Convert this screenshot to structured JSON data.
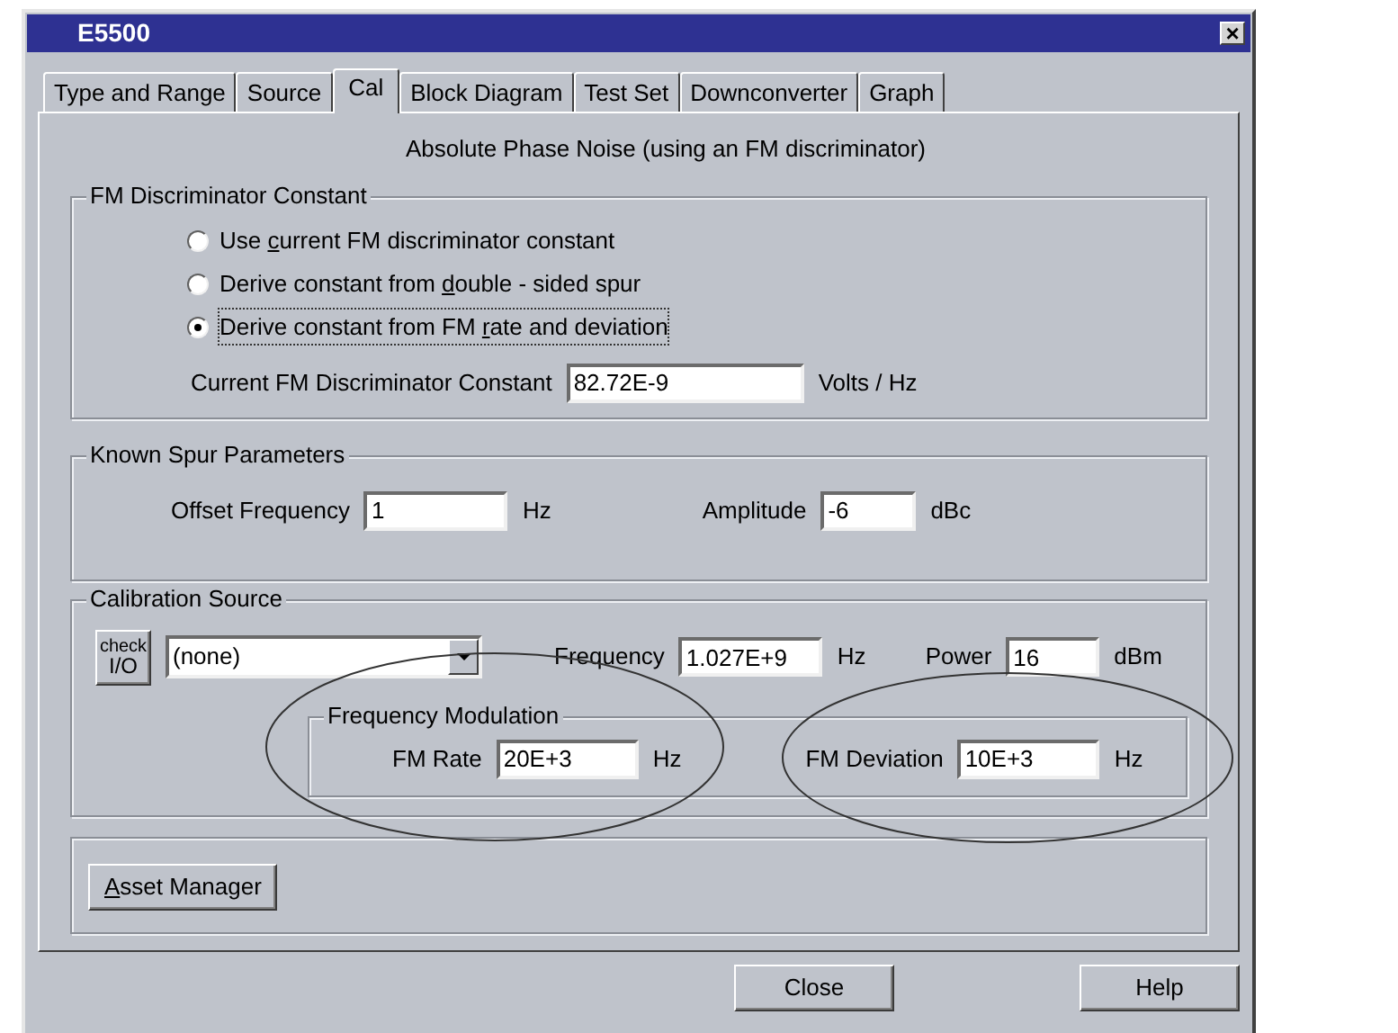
{
  "window": {
    "title": "E5500",
    "close_glyph": "×"
  },
  "tabs": [
    {
      "label": "Type and Range",
      "selected": false
    },
    {
      "label": "Source",
      "selected": false
    },
    {
      "label": "Cal",
      "selected": true
    },
    {
      "label": "Block Diagram",
      "selected": false
    },
    {
      "label": "Test Set",
      "selected": false
    },
    {
      "label": "Downconverter",
      "selected": false
    },
    {
      "label": "Graph",
      "selected": false
    }
  ],
  "heading": "Absolute Phase Noise (using an FM discriminator)",
  "discriminator": {
    "title": "FM Discriminator Constant",
    "options": [
      {
        "label_parts": [
          "Use ",
          "c",
          "urrent FM discriminator constant"
        ],
        "selected": false
      },
      {
        "label_parts": [
          "Derive constant from ",
          "d",
          "ouble - sided spur"
        ],
        "selected": false
      },
      {
        "label_parts": [
          "Derive constant from FM ",
          "r",
          "ate and deviation"
        ],
        "selected": true
      }
    ],
    "constant": {
      "label": "Current FM Discriminator Constant",
      "value": "82.72E-9",
      "unit": "Volts / Hz"
    }
  },
  "spur": {
    "title": "Known Spur Parameters",
    "offset": {
      "label": "Offset Frequency",
      "value": "1",
      "unit": "Hz"
    },
    "amplitude": {
      "label": "Amplitude",
      "value": "-6",
      "unit": "dBc"
    }
  },
  "calibration": {
    "title": "Calibration Source",
    "check_button": [
      "check",
      "I/O"
    ],
    "source": "(none)",
    "frequency": {
      "label": "Frequency",
      "value": "1.027E+9",
      "unit": "Hz"
    },
    "power": {
      "label": "Power",
      "value": "16",
      "unit": "dBm"
    },
    "modulation": {
      "title": "Frequency Modulation",
      "rate": {
        "label": "FM Rate",
        "value": "20E+3",
        "unit": "Hz"
      },
      "deviation": {
        "label": "FM Deviation",
        "value": "10E+3",
        "unit": "Hz"
      }
    }
  },
  "asset_button": [
    "A",
    "sset Manager"
  ],
  "buttons": [
    "Close",
    "Help"
  ]
}
